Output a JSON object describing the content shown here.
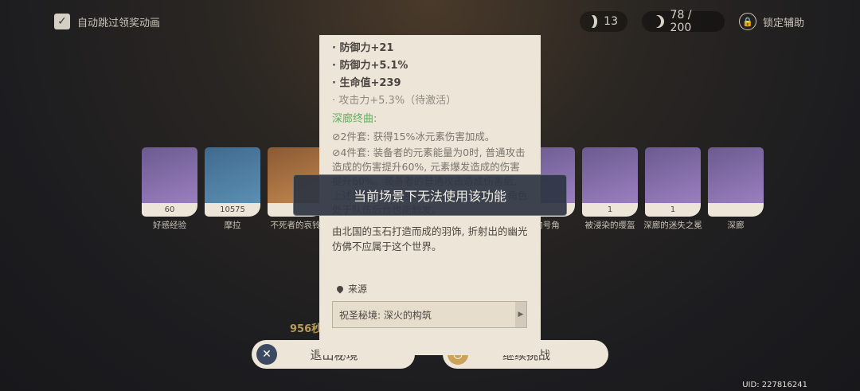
{
  "topbar": {
    "auto_skip_label": "自动跳过领奖动画",
    "resin_fragile": "13",
    "resin_original": "78 / 200",
    "lock_assist_label": "锁定辅助"
  },
  "rewards": [
    {
      "count": "60",
      "name": "好感经验",
      "rarity": "purple"
    },
    {
      "count": "10575",
      "name": "摩拉",
      "rarity": "blue"
    },
    {
      "count": "",
      "name": "不死者的哀铃",
      "rarity": "orange"
    },
    {
      "count": "",
      "name": "",
      "rarity": "purple"
    },
    {
      "count": "",
      "name": "",
      "rarity": "purple"
    },
    {
      "count": "",
      "name": "",
      "rarity": "purple"
    },
    {
      "count": "",
      "name": "的号角",
      "rarity": "purple"
    },
    {
      "count": "1",
      "name": "被浸染的缨盔",
      "rarity": "purple"
    },
    {
      "count": "1",
      "name": "深廊的迷失之冕",
      "rarity": "purple"
    },
    {
      "count": "",
      "name": "深廊",
      "rarity": "purple"
    }
  ],
  "artifact": {
    "stats": [
      "· 防御力+21",
      "· 防御力+5.1%",
      "· 生命值+239"
    ],
    "inactive_stat": "· 攻击力+5.3%（待激活）",
    "set_name": "深廊终曲:",
    "bonus_2": "⊘2件套: 获得15%冰元素伤害加成。",
    "bonus_4": "⊘4件套: 装备者的元素能量为0时, 普通攻击造成的伤害提升60%, 元素爆发造成的伤害提升60%。装备者的普通攻击造成伤害后, 上述普通攻击伤害提升效果将失效6秒。角色处于队伍后台也能触发。",
    "lore": "由北国的玉石打造而成的羽饰, 折射出的幽光仿佛不应属于这个世界。",
    "source_label": "来源",
    "source_domain": "祝圣秘境: 深火的构筑"
  },
  "toast": "当前场景下无法使用该功能",
  "bottom": {
    "reward_text": "956秒",
    "exit_label": "退出秘境",
    "continue_label": "继续挑战"
  },
  "uid": "UID: 227816241"
}
